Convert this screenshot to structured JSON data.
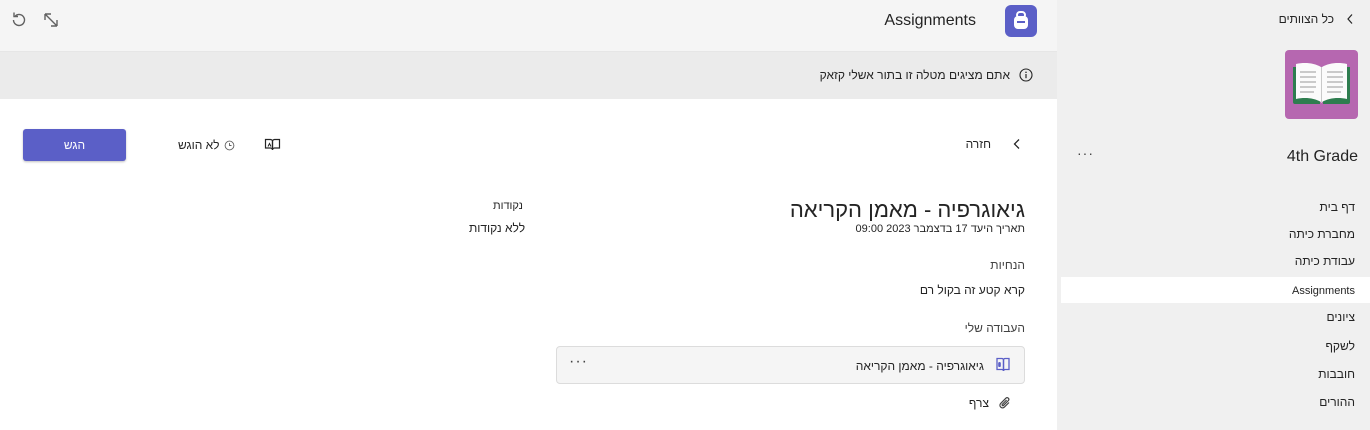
{
  "app": {
    "title": "Assignments"
  },
  "banner": {
    "text": "אתם מציגים מטלה זו בתור אשלי קזאק"
  },
  "toolbar": {
    "turn_in_label": "הגש",
    "status_label": "לא הוגש",
    "back_label": "חזרה"
  },
  "assignment": {
    "title": "גיאוגרפיה - מאמן הקריאה",
    "due": "תאריך היעד 17 בדצמבר 2023 09:00",
    "points_label": "נקודות",
    "points_value": "ללא נקודות",
    "instructions_label": "הנחיות",
    "instructions_text": "קרא קטע זה בקול רם",
    "my_work_label": "העבודה שלי",
    "work_item_name": "גיאוגרפיה - מאמן הקריאה",
    "work_item_more": "···",
    "attach_label": "צרף"
  },
  "sidebar": {
    "all_teams_label": "כל הצוותים",
    "team_name": "4th Grade",
    "team_more": "···",
    "items": [
      {
        "label": "דף בית"
      },
      {
        "label": "מחברת כיתה"
      },
      {
        "label": "עבודת כיתה"
      },
      {
        "label": "Assignments"
      },
      {
        "label": "ציונים"
      },
      {
        "label": "לשקף"
      },
      {
        "label": "חובבות"
      },
      {
        "label": "ההורים"
      }
    ],
    "active_index": 3
  },
  "colors": {
    "accent": "#5b5fc7",
    "team_avatar": "#b667b0",
    "sidebar_bg": "#f0f0f0",
    "banner_bg": "#ebebeb"
  },
  "icons": [
    "refresh-icon",
    "expand-icon",
    "assignments-app-icon",
    "info-icon",
    "immersive-reader-icon",
    "clock-icon",
    "chevron-left-icon",
    "reading-coach-icon",
    "paperclip-icon",
    "book-icon"
  ]
}
